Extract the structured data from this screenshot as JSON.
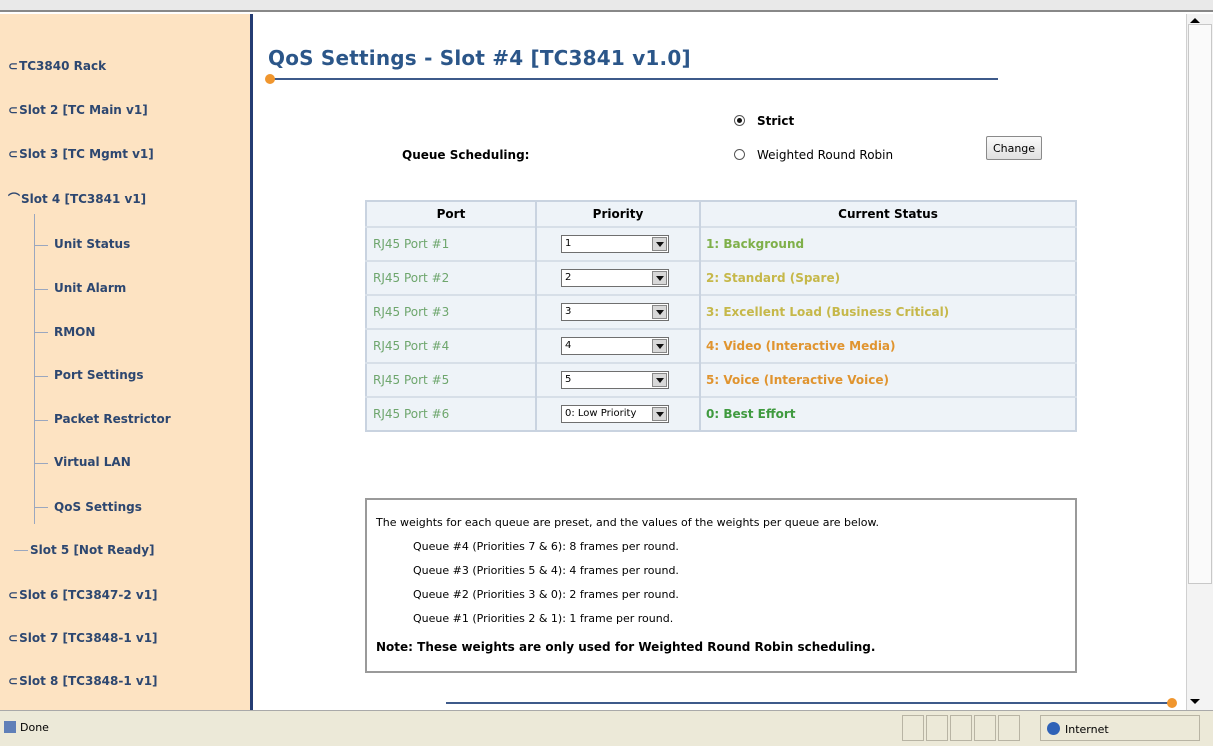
{
  "nav": {
    "items": [
      {
        "label": "TC3840 Rack",
        "glyph": "⊂"
      },
      {
        "label": "Slot 2 [TC Main v1]",
        "glyph": "⊂"
      },
      {
        "label": "Slot 3 [TC Mgmt v1]",
        "glyph": "⊂"
      },
      {
        "label": "Slot 4 [TC3841 v1]",
        "glyph": "⌒"
      },
      {
        "label": "Unit Status"
      },
      {
        "label": "Unit Alarm"
      },
      {
        "label": "RMON"
      },
      {
        "label": "Port Settings"
      },
      {
        "label": "Packet Restrictor"
      },
      {
        "label": "Virtual LAN"
      },
      {
        "label": "QoS Settings"
      },
      {
        "label": "Slot 5 [Not Ready]"
      },
      {
        "label": "Slot 6 [TC3847-2 v1]",
        "glyph": "⊂"
      },
      {
        "label": "Slot 7 [TC3848-1 v1]",
        "glyph": "⊂"
      },
      {
        "label": "Slot 8 [TC3848-1 v1]",
        "glyph": "⊂"
      }
    ]
  },
  "page": {
    "title": "QoS Settings - Slot #4 [TC3841 v1.0]",
    "accent": "#f0962e",
    "title_color": "#2b5689"
  },
  "scheduling": {
    "label": "Queue Scheduling:",
    "options": [
      "Strict",
      "Weighted Round Robin"
    ],
    "selected": "Strict",
    "change_label": "Change"
  },
  "table": {
    "headers": [
      "Port",
      "Priority",
      "Current Status"
    ],
    "rows": [
      {
        "port": "RJ45 Port #1",
        "priority": "1",
        "status": "1: Background",
        "status_color": "#7fb04a"
      },
      {
        "port": "RJ45 Port #2",
        "priority": "2",
        "status": "2: Standard (Spare)",
        "status_color": "#c6b84a"
      },
      {
        "port": "RJ45 Port #3",
        "priority": "3",
        "status": "3: Excellent Load (Business Critical)",
        "status_color": "#c6b84a"
      },
      {
        "port": "RJ45 Port #4",
        "priority": "4",
        "status": "4: Video (Interactive Media)",
        "status_color": "#e0942f"
      },
      {
        "port": "RJ45 Port #5",
        "priority": "5",
        "status": "5: Voice (Interactive Voice)",
        "status_color": "#e0942f"
      },
      {
        "port": "RJ45 Port #6",
        "priority": "0: Low Priority",
        "status": "0: Best Effort",
        "status_color": "#3f9a3f"
      }
    ]
  },
  "info": {
    "intro": "The weights for each queue are preset, and the values of the weights per queue are below.",
    "queues": [
      "Queue #4 (Priorities 7 & 6): 8 frames per round.",
      "Queue #3 (Priorities 5 & 4): 4 frames per round.",
      "Queue #2 (Priorities 3 & 0): 2 frames per round.",
      "Queue #1 (Priorities 2 & 1): 1 frame per round."
    ],
    "note": "Note: These weights are only used for Weighted Round Robin scheduling."
  },
  "statusbar": {
    "left": "Done",
    "zone": "Internet"
  }
}
